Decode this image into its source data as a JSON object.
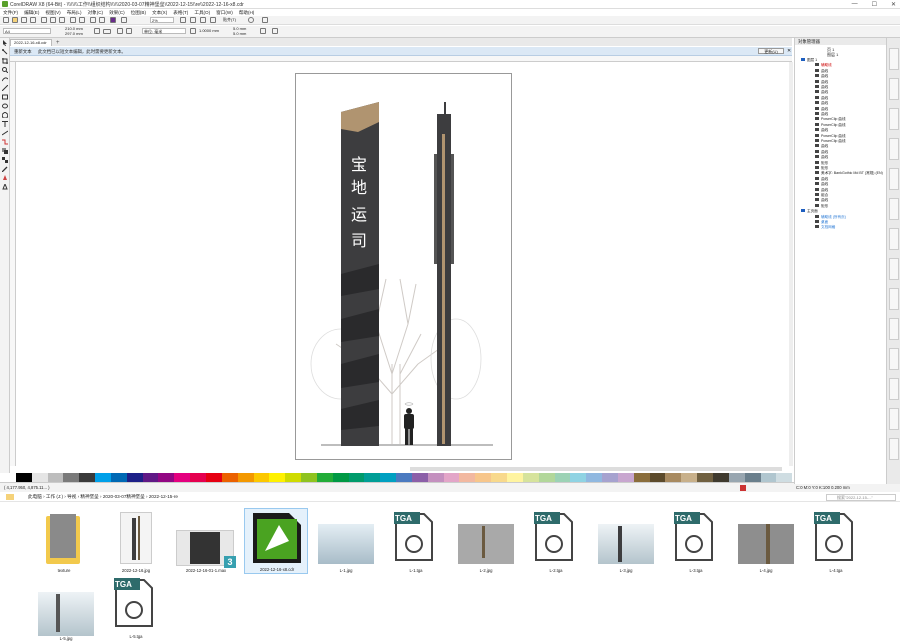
{
  "titlebar": {
    "title": "CorelDRAW X8 (64-Bit) - \\\\\\\\\\\\\\\\工作\\\\组织结构\\\\\\\\\\\\2020-03-07精神堡垒\\\\2022-12-15\\\\re\\\\2022-12-16-x8.cdr",
    "controls": [
      "—",
      "☐",
      "✕"
    ]
  },
  "menu": [
    "文件(F)",
    "编辑(E)",
    "视图(V)",
    "布局(L)",
    "对象(C)",
    "效果(C)",
    "位图(B)",
    "文本(X)",
    "表格(T)",
    "工具(O)",
    "窗口(W)",
    "帮助(H)"
  ],
  "toolbar": {
    "zoom": "2%",
    "snap": "贴齐(T)",
    "page_size": "A4",
    "width": "210.0 mm",
    "height": "297.0 mm",
    "units": "单位: 毫米",
    "nudge": "1.0000 mm",
    "dup_x": "5.0 mm",
    "dup_y": "5.0 mm"
  },
  "doc_tab": "2022-12-16-x8.cdr",
  "message": {
    "label": "重新文本",
    "text": "此文档已以短文本编辑，此时需要更新文本。",
    "button": "更新(U)"
  },
  "artwork": {
    "chars": [
      "宝",
      "地",
      "运",
      "司"
    ]
  },
  "status": {
    "coords": "( 4,177.950, 4,875.11... )",
    "fill": "C:0 M:0 Y:0 K:100 0.200 mm"
  },
  "panel": {
    "title": "对象管理器",
    "sub": "页 1",
    "layer": "图层 1",
    "rows": [
      "图层 1",
      "辅助线",
      "曲线",
      "曲线",
      "曲线",
      "曲线",
      "曲线",
      "曲线",
      "曲线",
      "曲线",
      "曲线",
      "PowerClip 曲线",
      "PowerClip 曲线",
      "曲线",
      "PowerClip 曲线",
      "PowerClip 曲线",
      "曲线",
      "曲线",
      "曲线",
      "矩形",
      "矩形",
      "美术字: BankGothic Md BT (常规) (EN)",
      "曲线",
      "曲线",
      "曲线",
      "组合",
      "曲线",
      "矩形",
      "主页面",
      "辅助线 (所有页)",
      "桌面",
      "文档网格"
    ]
  },
  "explorer": {
    "path": [
      "此电脑",
      "工作 (J:)",
      "导视",
      "精神堡垒",
      "2020-03-07精神堡垒",
      "2022-12-15-re"
    ],
    "search": "搜索\"2022-12-15-...\"",
    "files": [
      "texture",
      "2022-12-16.jpg",
      "2022-12-16-01-1.max",
      "2022-12-16-x8.cdr",
      "L-1.jpg",
      "L-1.tga",
      "L-2.jpg",
      "L-2.tga",
      "L-3.jpg",
      "L-3.tga",
      "L-4.jpg",
      "L-4.tga",
      "L-5.jpg",
      "L-5.tga"
    ],
    "badge": "3",
    "tga_label": "TGA"
  },
  "colors": {
    "accent": "#2b7bd6",
    "tower": "#3d3d3f",
    "gold": "#b09470"
  },
  "palette": [
    "#ffffff",
    "#000000",
    "#e5e5e5",
    "#bdbdbd",
    "#7a7a7a",
    "#3a3a3a",
    "#00a0e9",
    "#0069b4",
    "#1d2088",
    "#601986",
    "#920783",
    "#e4007f",
    "#e5004f",
    "#e60012",
    "#eb6100",
    "#f39800",
    "#fcc800",
    "#fff100",
    "#cfdb00",
    "#8fc31f",
    "#22ac38",
    "#009944",
    "#009b6b",
    "#009e96",
    "#00a0c1",
    "#4b7ac0",
    "#8c5fa8",
    "#c490bf",
    "#e3a5c8",
    "#f2b8a0",
    "#f7c68b",
    "#f8d98c",
    "#fff4a0",
    "#d6e39c",
    "#b2d79a",
    "#9cd2b5",
    "#8fd3e3",
    "#90b8e0",
    "#a6a2cf",
    "#c8a6cf",
    "#8a6d3b",
    "#5c4a2b",
    "#a88a60",
    "#c8b08a",
    "#706040",
    "#3f3a2e",
    "#98a6b0",
    "#6a7f8c",
    "#b0c6cf",
    "#cfdde2"
  ]
}
